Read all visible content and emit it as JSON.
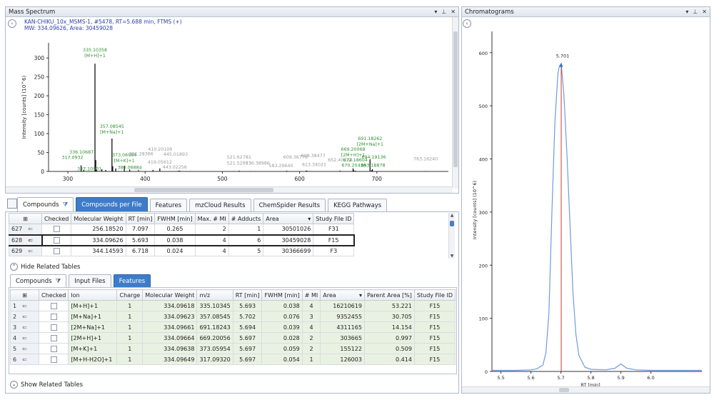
{
  "ms_panel": {
    "title": "Mass Spectrum",
    "info_line1": "KAN-CHIKU_10x_MSMS-1, #5478, RT=5.688 min, FTMS (+)",
    "info_line2": "MW: 334.09626, Area: 30459028",
    "ylabel": "Intensity [counts] (10^6)",
    "xlabel": "m/z"
  },
  "chrom_panel": {
    "title": "Chromatograms",
    "ylabel": "Intensity [counts] (10^6)",
    "xlabel": "RT [min]",
    "peak_label": "5.701"
  },
  "window_ctrls": {
    "pin": "▾ ⊥ ✕"
  },
  "main_tabs": [
    {
      "label": "Compounds"
    },
    {
      "label": "Compounds per File"
    },
    {
      "label": "Features"
    },
    {
      "label": "mzCloud Results"
    },
    {
      "label": "ChemSpider Results"
    },
    {
      "label": "KEGG Pathways"
    }
  ],
  "upper_table": {
    "headers": [
      "Checked",
      "Molecular Weight",
      "RT [min]",
      "FWHM [min]",
      "Max. # MI",
      "# Adducts",
      "Area",
      "Study File ID"
    ],
    "rows": [
      {
        "id": "627",
        "mw": "256.18520",
        "rt": "7.097",
        "fwhm": "0.265",
        "maxmi": "2",
        "adducts": "1",
        "area": "30501026",
        "file": "F31"
      },
      {
        "id": "628",
        "mw": "334.09626",
        "rt": "5.693",
        "fwhm": "0.038",
        "maxmi": "4",
        "adducts": "6",
        "area": "30459028",
        "file": "F15"
      },
      {
        "id": "629",
        "mw": "344.14593",
        "rt": "6.718",
        "fwhm": "0.024",
        "maxmi": "4",
        "adducts": "5",
        "area": "30366699",
        "file": "F3"
      }
    ]
  },
  "hide_related": "Hide Related Tables",
  "sub_tabs": [
    {
      "label": "Compounds"
    },
    {
      "label": "Input Files"
    },
    {
      "label": "Features"
    }
  ],
  "lower_table": {
    "headers": [
      "Checked",
      "Ion",
      "Charge",
      "Molecular Weight",
      "m/z",
      "RT [min]",
      "FWHM [min]",
      "# MI",
      "Area",
      "Parent Area [%]",
      "Study File ID"
    ],
    "rows": [
      {
        "id": "1",
        "ion": "[M+H]+1",
        "charge": "1",
        "mw": "334.09618",
        "mz": "335.10345",
        "rt": "5.693",
        "fwhm": "0.038",
        "mi": "4",
        "area": "16210619",
        "parent": "53.221",
        "file": "F15"
      },
      {
        "id": "2",
        "ion": "[M+Na]+1",
        "charge": "1",
        "mw": "334.09623",
        "mz": "357.08545",
        "rt": "5.702",
        "fwhm": "0.076",
        "mi": "3",
        "area": "9352455",
        "parent": "30.705",
        "file": "F15"
      },
      {
        "id": "3",
        "ion": "[2M+Na]+1",
        "charge": "1",
        "mw": "334.09661",
        "mz": "691.18243",
        "rt": "5.694",
        "fwhm": "0.039",
        "mi": "4",
        "area": "4311165",
        "parent": "14.154",
        "file": "F15"
      },
      {
        "id": "4",
        "ion": "[2M+H]+1",
        "charge": "1",
        "mw": "334.09664",
        "mz": "669.20056",
        "rt": "5.697",
        "fwhm": "0.028",
        "mi": "2",
        "area": "303665",
        "parent": "0.997",
        "file": "F15"
      },
      {
        "id": "5",
        "ion": "[M+K]+1",
        "charge": "1",
        "mw": "334.09638",
        "mz": "373.05954",
        "rt": "5.697",
        "fwhm": "0.059",
        "mi": "2",
        "area": "155122",
        "parent": "0.509",
        "file": "F15"
      },
      {
        "id": "6",
        "ion": "[M+H-H2O]+1",
        "charge": "1",
        "mw": "334.09649",
        "mz": "317.09320",
        "rt": "5.697",
        "fwhm": "0.054",
        "mi": "1",
        "area": "126003",
        "parent": "0.414",
        "file": "F15"
      }
    ]
  },
  "show_related": "Show Related Tables",
  "chart_data": [
    {
      "type": "bar",
      "xlabel": "m/z",
      "ylabel": "Intensity [counts] (10^6)",
      "xlim": [
        275,
        800
      ],
      "ylim": [
        0,
        340
      ],
      "xticks": [
        300,
        400,
        500,
        600,
        700
      ],
      "yticks": [
        0,
        50,
        100,
        150,
        200,
        250,
        300
      ],
      "peaks": [
        {
          "mz": 317.0932,
          "y": 16,
          "label": "317.0932",
          "c": "#2f8f2f"
        },
        {
          "mz": 320.5,
          "y": 4,
          "label": "",
          "c": "#777"
        },
        {
          "mz": 335.10358,
          "y": 285,
          "label": "335.10358",
          "sub": "[M+H]+1",
          "c": "#2f8f2f"
        },
        {
          "mz": 336.10687,
          "y": 30,
          "label": "336.10687",
          "c": "#2f8f2f"
        },
        {
          "mz": 337.10931,
          "y": 5,
          "label": "337.10931",
          "c": "#2f8f2f"
        },
        {
          "mz": 344,
          "y": 6,
          "label": "",
          "c": "#777"
        },
        {
          "mz": 349,
          "y": 4,
          "label": "",
          "c": "#777"
        },
        {
          "mz": 357.08545,
          "y": 87,
          "label": "357.08545",
          "sub": "[M+Na]+1",
          "c": "#2f8f2f"
        },
        {
          "mz": 358.09,
          "y": 14,
          "label": "",
          "c": "#777"
        },
        {
          "mz": 362,
          "y": 8,
          "label": "",
          "c": "#777"
        },
        {
          "mz": 373.06984,
          "y": 15,
          "label": "373.06984",
          "sub": "[M+K]+1",
          "c": "#2f8f2f"
        },
        {
          "mz": 380.06884,
          "y": 5,
          "label": "380.06884",
          "c": "#2f8f2f"
        },
        {
          "mz": 391.28366,
          "y": 3,
          "label": "391.28366",
          "c": "#999"
        },
        {
          "mz": 410.20109,
          "y": 4,
          "label": "410.20109",
          "c": "#999"
        },
        {
          "mz": 419.05612,
          "y": 8,
          "label": "419.05612",
          "c": "#999"
        },
        {
          "mz": 443.02256,
          "y": 2,
          "label": "443.02256",
          "c": "#999"
        },
        {
          "mz": 445.01893,
          "y": 2,
          "label": "445.01893",
          "c": "#999"
        },
        {
          "mz": 521.62781,
          "y": 2,
          "label": "521.62781",
          "c": "#999"
        },
        {
          "mz": 521.52973,
          "y": 1,
          "label": "521.52973",
          "c": "#999"
        },
        {
          "mz": 536.38986,
          "y": 1,
          "label": "536.38986",
          "c": "#999"
        },
        {
          "mz": 583.2964,
          "y": 2,
          "label": "583.29640",
          "c": "#999"
        },
        {
          "mz": 609.36776,
          "y": 2,
          "label": "609.36776",
          "c": "#999"
        },
        {
          "mz": 608.38477,
          "y": 2,
          "label": "608.38477",
          "c": "#999"
        },
        {
          "mz": 613.34021,
          "y": 1,
          "label": "613.34021",
          "c": "#999"
        },
        {
          "mz": 652.40234,
          "y": 2,
          "label": "652.40234",
          "c": "#999"
        },
        {
          "mz": 669.20068,
          "y": 8,
          "label": "669.20068",
          "sub": "[2M+H]+1",
          "c": "#2f8f2f"
        },
        {
          "mz": 670.20436,
          "y": 3,
          "label": "670.20436",
          "c": "#2f8f2f"
        },
        {
          "mz": 672.18604,
          "y": 2,
          "label": "672.18604",
          "c": "#2f8f2f"
        },
        {
          "mz": 691.18262,
          "y": 32,
          "label": "691.18262",
          "sub": "[2M+Na]+1",
          "c": "#2f8f2f"
        },
        {
          "mz": 694.19136,
          "y": 6,
          "label": "694.19136",
          "c": "#2f8f2f"
        },
        {
          "mz": 693.18878,
          "y": 3,
          "label": "693.18878",
          "c": "#2f8f2f"
        },
        {
          "mz": 763.1624,
          "y": 1,
          "label": "763.16240",
          "c": "#999"
        }
      ]
    },
    {
      "type": "line",
      "xlabel": "RT [min]",
      "ylabel": "Intensity [counts] (10^6)",
      "xlim": [
        5.47,
        6.17
      ],
      "ylim": [
        0,
        640
      ],
      "xticks": [
        5.5,
        5.6,
        5.7,
        5.8,
        5.9,
        6.0
      ],
      "yticks": [
        0,
        100,
        200,
        300,
        400,
        500,
        600
      ],
      "apex_rt": 5.701,
      "x": [
        5.47,
        5.55,
        5.6,
        5.62,
        5.64,
        5.65,
        5.66,
        5.67,
        5.68,
        5.69,
        5.695,
        5.701,
        5.71,
        5.72,
        5.73,
        5.74,
        5.75,
        5.76,
        5.78,
        5.8,
        5.85,
        5.88,
        5.9,
        5.92,
        5.95,
        6.0,
        6.1,
        6.17
      ],
      "y": [
        2,
        2,
        3,
        5,
        12,
        35,
        110,
        300,
        470,
        560,
        575,
        580,
        520,
        410,
        280,
        150,
        70,
        30,
        8,
        4,
        3,
        6,
        14,
        6,
        3,
        2,
        2,
        2
      ]
    }
  ]
}
